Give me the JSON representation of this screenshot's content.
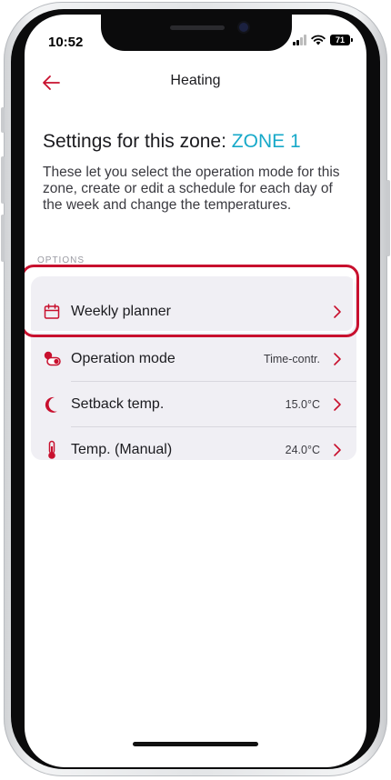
{
  "status_bar": {
    "time": "10:52",
    "battery": "71"
  },
  "header": {
    "title": "Heating"
  },
  "zone": {
    "title_prefix": "Settings for this zone: ",
    "name": "ZONE 1",
    "description": "These let you select the operation mode for this zone, create or edit a schedule for each day of the week and change the temperatures."
  },
  "options_label": "OPTIONS",
  "options": [
    {
      "label": "Weekly planner",
      "value": "",
      "icon": "calendar-icon"
    },
    {
      "label": "Operation mode",
      "value": "Time-contr.",
      "icon": "toggle-icon"
    },
    {
      "label": "Setback temp.",
      "value": "15.0°C",
      "icon": "moon-icon"
    },
    {
      "label": "Temp. (Manual)",
      "value": "24.0°C",
      "icon": "thermometer-icon"
    }
  ],
  "colors": {
    "accent": "#c8102e",
    "zone": "#17a9c9",
    "card": "#f0eff4"
  }
}
